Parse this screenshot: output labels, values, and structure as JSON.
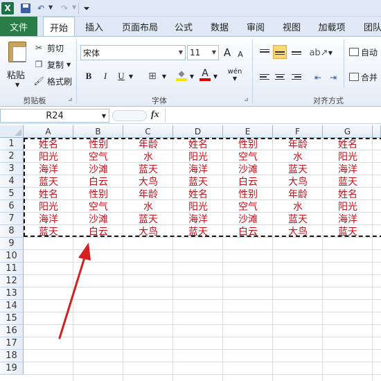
{
  "qat": {
    "excel_logo": "X",
    "undo_glyph": "↶",
    "redo_glyph": "↷"
  },
  "tabs": [
    "文件",
    "开始",
    "插入",
    "页面布局",
    "公式",
    "数据",
    "审阅",
    "视图",
    "加载项",
    "团队"
  ],
  "clipboard": {
    "paste": "粘贴",
    "cut": "剪切",
    "copy": "复制",
    "format_painter": "格式刷",
    "group_label": "剪贴板"
  },
  "font": {
    "name": "宋体",
    "size": "11",
    "grow": "A",
    "shrink": "A",
    "bold": "B",
    "italic": "I",
    "underline": "U",
    "fill_glyph": "◆",
    "font_color_glyph": "A",
    "phonetic": "wén",
    "group_label": "字体"
  },
  "alignment": {
    "wrap_text": "自动",
    "merge": "合并",
    "group_label": "对齐方式"
  },
  "formula_bar": {
    "name_box": "R24",
    "fx": "fx",
    "value": ""
  },
  "columns": [
    "A",
    "B",
    "C",
    "D",
    "E",
    "F",
    "G"
  ],
  "rows": [
    "1",
    "2",
    "3",
    "4",
    "5",
    "6",
    "7",
    "8",
    "9",
    "10",
    "11",
    "12",
    "13",
    "14",
    "15",
    "16",
    "17",
    "18",
    "19"
  ],
  "cells": [
    [
      "姓名",
      "性别",
      "年龄",
      "姓名",
      "性别",
      "年龄",
      "姓名"
    ],
    [
      "阳光",
      "空气",
      "水",
      "阳光",
      "空气",
      "水",
      "阳光"
    ],
    [
      "海洋",
      "沙滩",
      "蓝天",
      "海洋",
      "沙滩",
      "蓝天",
      "海洋"
    ],
    [
      "蓝天",
      "白云",
      "大鸟",
      "蓝天",
      "白云",
      "大鸟",
      "蓝天"
    ],
    [
      "姓名",
      "性别",
      "年龄",
      "姓名",
      "性别",
      "年龄",
      "姓名"
    ],
    [
      "阳光",
      "空气",
      "水",
      "阳光",
      "空气",
      "水",
      "阳光"
    ],
    [
      "海洋",
      "沙滩",
      "蓝天",
      "海洋",
      "沙滩",
      "蓝天",
      "海洋"
    ],
    [
      "蓝天",
      "白云",
      "大鸟",
      "蓝天",
      "白云",
      "大鸟",
      "蓝天"
    ]
  ],
  "colors": {
    "cell_text": "#c0121c",
    "file_tab": "#2a7d47",
    "arrow": "#d42020"
  }
}
